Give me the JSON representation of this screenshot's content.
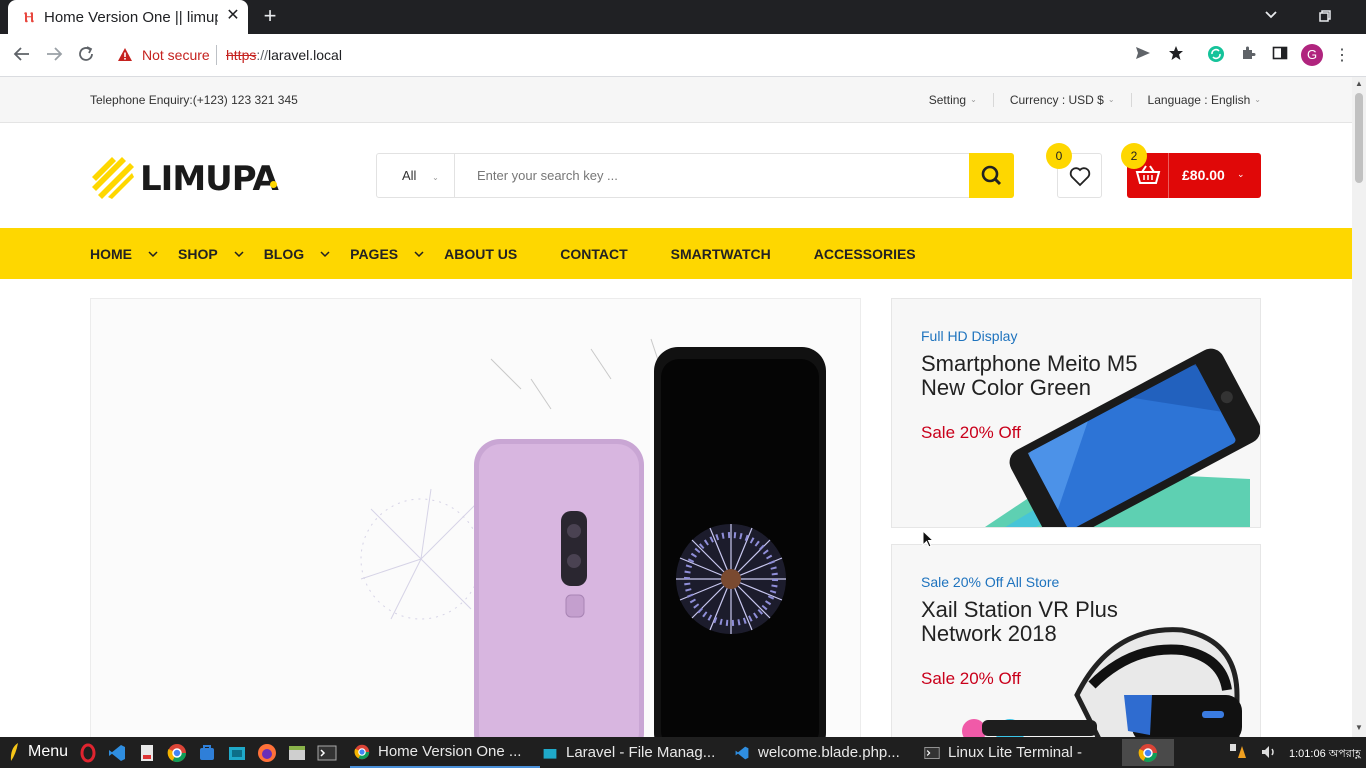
{
  "browser": {
    "tab_title": "Home Version One || limupa",
    "not_secure_label": "Not secure",
    "url_scheme": "https",
    "url_sep": "://",
    "url_host": "laravel.local"
  },
  "topbar": {
    "phone": "Telephone Enquiry:(+123) 123 321 345",
    "setting": "Setting",
    "currency": "Currency : USD $",
    "language": "Language : English"
  },
  "header": {
    "logo_text": "LIMUPA",
    "search_category": "All",
    "search_placeholder": "Enter your search key ...",
    "wishlist_count": "0",
    "cart_count": "2",
    "cart_total": "£80.00"
  },
  "nav": {
    "items": [
      {
        "label": "HOME",
        "has_sub": true
      },
      {
        "label": "SHOP",
        "has_sub": true
      },
      {
        "label": "BLOG",
        "has_sub": true
      },
      {
        "label": "PAGES",
        "has_sub": true
      },
      {
        "label": "ABOUT US",
        "has_sub": false
      },
      {
        "label": "CONTACT",
        "has_sub": false
      },
      {
        "label": "SMARTWATCH",
        "has_sub": false
      },
      {
        "label": "ACCESSORIES",
        "has_sub": false
      }
    ]
  },
  "promos": [
    {
      "kicker": "Full HD Display",
      "title": "Smartphone Meito M5 New Color Green",
      "sale": "Sale 20% Off"
    },
    {
      "kicker": "Sale 20% Off All Store",
      "title": "Xail Station VR Plus Network 2018",
      "sale": "Sale 20% Off"
    }
  ],
  "taskbar": {
    "menu_label": "Menu",
    "tasks": [
      "Home Version One ...",
      "Laravel - File Manag...",
      "welcome.blade.php...",
      "Linux Lite Terminal -"
    ],
    "time": "1:01:06 অপরাহ্ণ"
  },
  "colors": {
    "brand_yellow": "#fed700",
    "cart_red": "#e00808",
    "link_blue": "#1e73be",
    "sale_red": "#c9001b"
  }
}
